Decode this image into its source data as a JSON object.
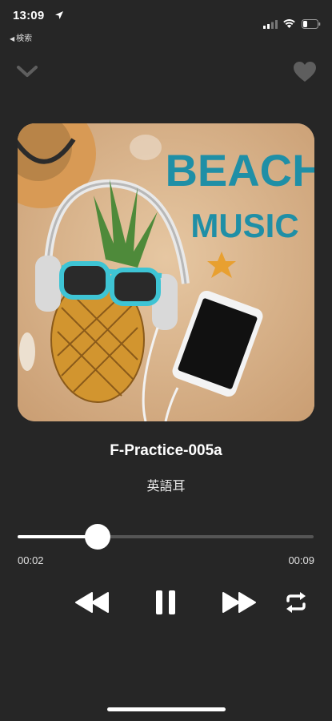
{
  "status_bar": {
    "time": "13:09",
    "back_label": "検索"
  },
  "track": {
    "title": "F-Practice-005a",
    "artist": "英語耳"
  },
  "artwork": {
    "line1": "BEACH",
    "line2": "MUSIC"
  },
  "playback": {
    "elapsed": "00:02",
    "total": "00:09",
    "progress_fraction": 0.27,
    "state": "playing"
  },
  "icons": {
    "collapse": "chevron-down-icon",
    "favorite": "heart-icon",
    "rewind": "rewind-icon",
    "pause": "pause-icon",
    "fast_forward": "fast-forward-icon",
    "repeat": "repeat-icon"
  },
  "colors": {
    "background": "#262626",
    "accent": "#ffffff",
    "track_inactive": "#555555",
    "artwork_text": "#1f8fa6"
  }
}
